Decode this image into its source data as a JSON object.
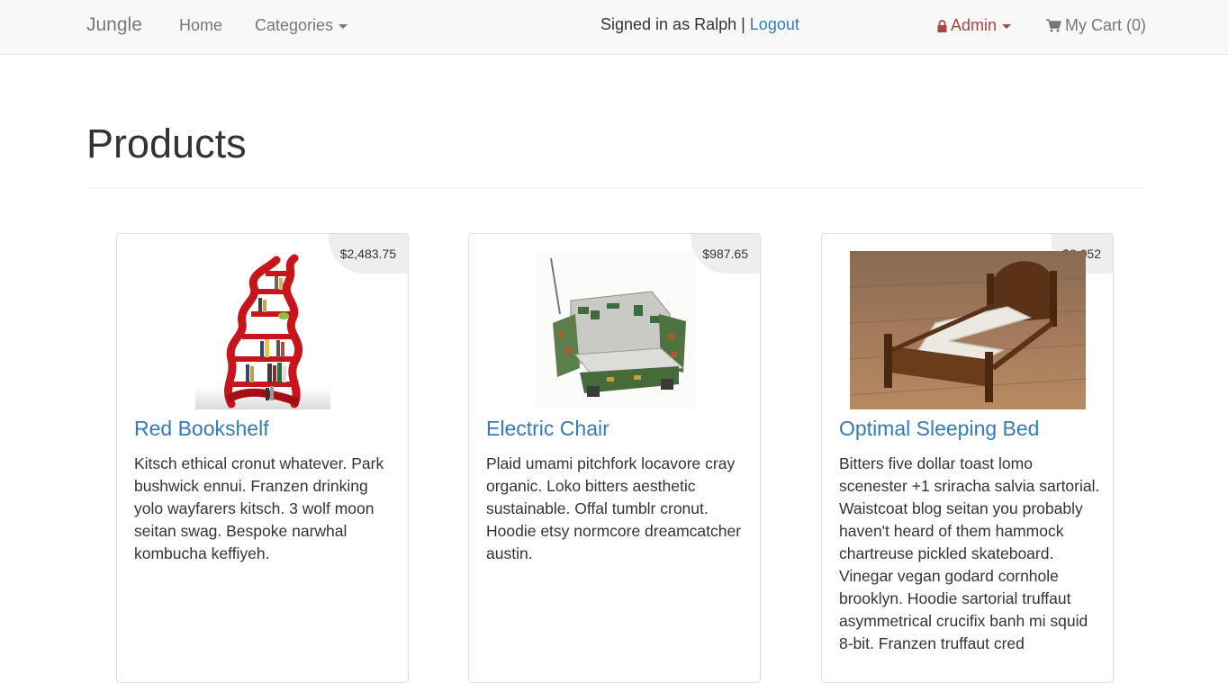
{
  "nav": {
    "brand": "Jungle",
    "home": "Home",
    "categories": "Categories",
    "signed_in": "Signed in as Ralph |",
    "logout": "Logout",
    "admin": "Admin",
    "cart": "My Cart (0)"
  },
  "page": {
    "title": "Products"
  },
  "products": [
    {
      "name": "Red Bookshelf",
      "price": "$2,483.75",
      "description": "Kitsch ethical cronut whatever. Park bushwick ennui. Franzen drinking yolo wayfarers kitsch. 3 wolf moon seitan swag. Bespoke narwhal kombucha keffiyeh."
    },
    {
      "name": "Electric Chair",
      "price": "$987.65",
      "description": "Plaid umami pitchfork locavore cray organic. Loko bitters aesthetic sustainable. Offal tumblr cronut. Hoodie etsy normcore dreamcatcher austin."
    },
    {
      "name": "Optimal Sleeping Bed",
      "price": "$3,052",
      "description": "Bitters five dollar toast lomo scenester +1 sriracha salvia sartorial. Waistcoat blog seitan you probably haven't heard of them hammock chartreuse pickled skateboard. Vinegar vegan godard cornhole brooklyn. Hoodie sartorial truffaut asymmetrical crucifix banh mi squid 8-bit. Franzen truffaut cred"
    }
  ],
  "colors": {
    "link": "#337ab7",
    "admin": "#a94442",
    "navbar_bg": "#f8f8f8",
    "price_tag_bg": "#eeeeee"
  },
  "icons": {
    "admin": "lock-icon",
    "cart": "shopping-cart-icon",
    "dropdown": "caret-down-icon"
  }
}
